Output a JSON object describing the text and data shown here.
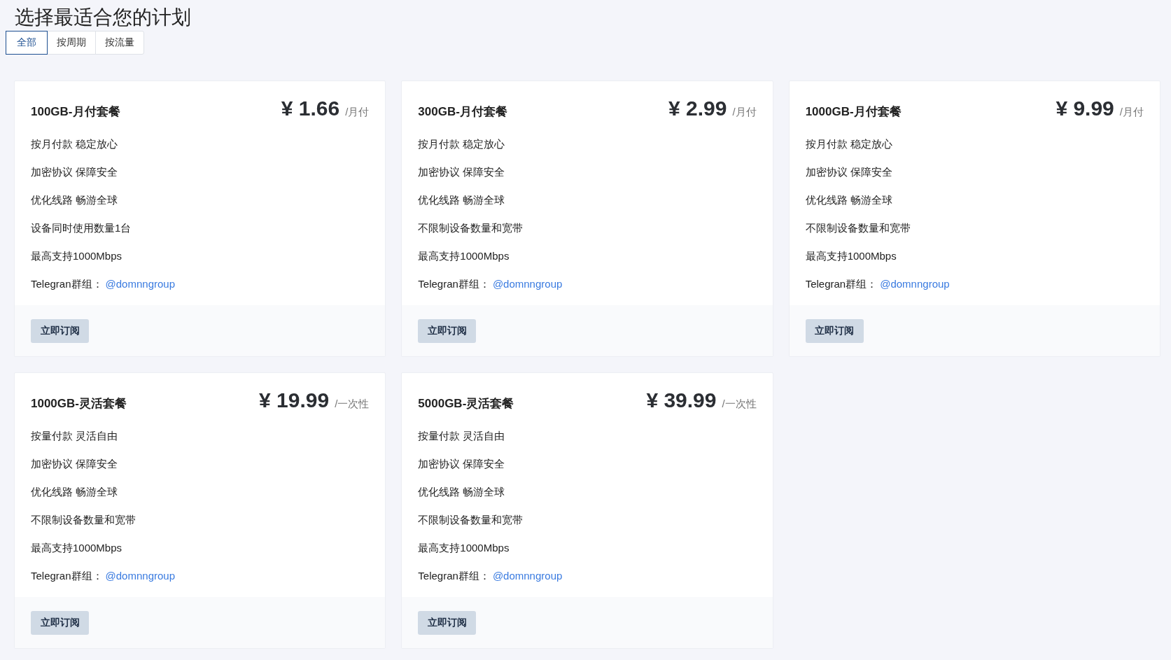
{
  "title": "选择最适合您的计划",
  "tabs": [
    {
      "label": "全部",
      "selected": true
    },
    {
      "label": "按周期",
      "selected": false
    },
    {
      "label": "按流量",
      "selected": false
    }
  ],
  "plans": [
    {
      "name": "100GB-月付套餐",
      "price": "¥ 1.66",
      "period": "/月付",
      "features": [
        "按月付款 稳定放心",
        "加密协议 保障安全",
        "优化线路 畅游全球",
        "设备同时使用数量1台",
        "最高支持1000Mbps"
      ],
      "telegram": {
        "label": "Telegran群组：",
        "link": "@domnngroup"
      },
      "button": "立即订阅"
    },
    {
      "name": "300GB-月付套餐",
      "price": "¥ 2.99",
      "period": "/月付",
      "features": [
        "按月付款 稳定放心",
        "加密协议 保障安全",
        "优化线路 畅游全球",
        "不限制设备数量和宽带",
        "最高支持1000Mbps"
      ],
      "telegram": {
        "label": "Telegran群组：",
        "link": "@domnngroup"
      },
      "button": "立即订阅"
    },
    {
      "name": "1000GB-月付套餐",
      "price": "¥ 9.99",
      "period": "/月付",
      "features": [
        "按月付款 稳定放心",
        "加密协议 保障安全",
        "优化线路 畅游全球",
        "不限制设备数量和宽带",
        "最高支持1000Mbps"
      ],
      "telegram": {
        "label": "Telegran群组：",
        "link": "@domnngroup"
      },
      "button": "立即订阅"
    },
    {
      "name": "1000GB-灵活套餐",
      "price": "¥ 19.99",
      "period": "/一次性",
      "features": [
        "按量付款 灵活自由",
        "加密协议 保障安全",
        "优化线路 畅游全球",
        "不限制设备数量和宽带",
        "最高支持1000Mbps"
      ],
      "telegram": {
        "label": "Telegran群组：",
        "link": "@domnngroup"
      },
      "button": "立即订阅"
    },
    {
      "name": "5000GB-灵活套餐",
      "price": "¥ 39.99",
      "period": "/一次性",
      "features": [
        "按量付款 灵活自由",
        "加密协议 保障安全",
        "优化线路 畅游全球",
        "不限制设备数量和宽带",
        "最高支持1000Mbps"
      ],
      "telegram": {
        "label": "Telegran群组：",
        "link": "@domnngroup"
      },
      "button": "立即订阅"
    }
  ]
}
